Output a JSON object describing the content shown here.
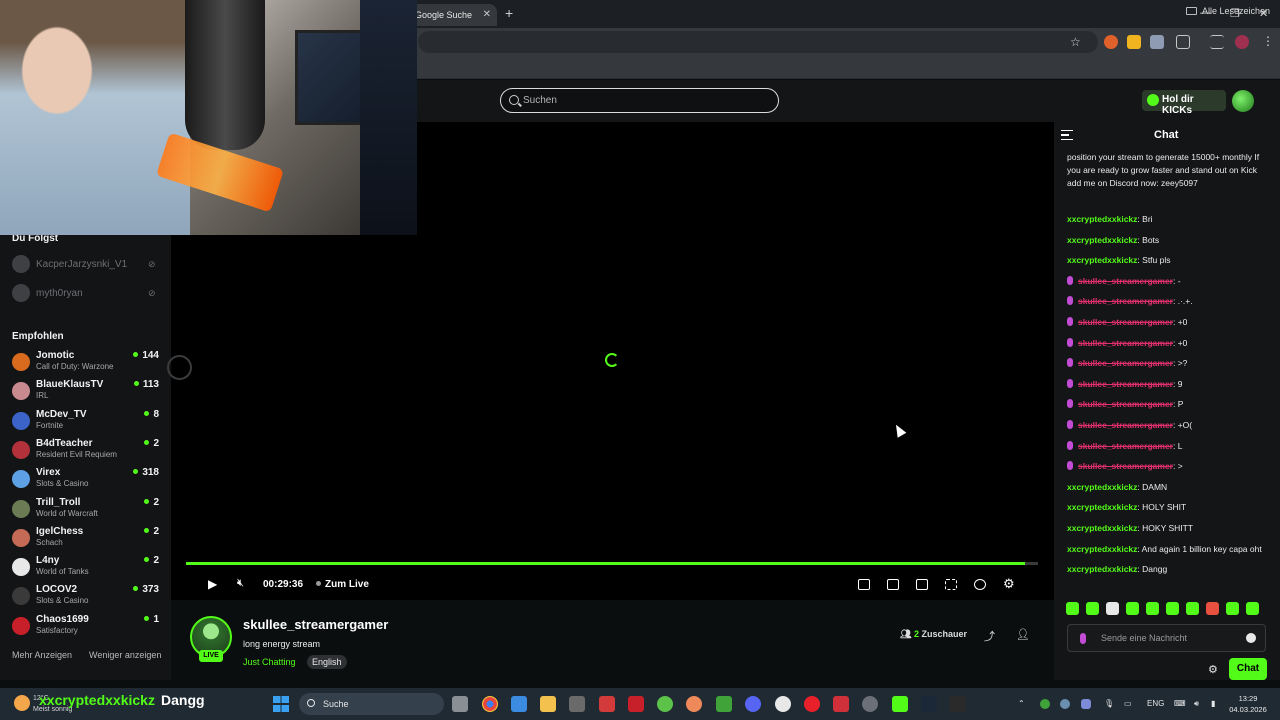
{
  "browser": {
    "tab_title": "Google Suche",
    "tab_close": "✕",
    "new_tab": "+",
    "bookmarks_all": "Alle Lesezeichen"
  },
  "header": {
    "search_placeholder": "Suchen",
    "kicks_button": "Hol dir KICKs"
  },
  "sidebar": {
    "following_heading": "Du Folgst",
    "following": [
      {
        "name": "KacperJarzysnki_V1"
      },
      {
        "name": "myth0ryan"
      }
    ],
    "recommended_heading": "Empfohlen",
    "recommended": [
      {
        "name": "Jomotic",
        "category": "Call of Duty: Warzone",
        "viewers": "144",
        "color": "#d96b1e"
      },
      {
        "name": "BlaueKlausTV",
        "category": "IRL",
        "viewers": "113",
        "color": "#c98a8f"
      },
      {
        "name": "McDev_TV",
        "category": "Fortnite",
        "viewers": "8",
        "color": "#3c64c8"
      },
      {
        "name": "B4dTeacher",
        "category": "Resident Evil Requiem",
        "viewers": "2",
        "color": "#b2313a"
      },
      {
        "name": "Virex",
        "category": "Slots & Casino",
        "viewers": "318",
        "color": "#5ea0e4"
      },
      {
        "name": "Trill_Troll",
        "category": "World of Warcraft",
        "viewers": "2",
        "color": "#6b7c54"
      },
      {
        "name": "IgelChess",
        "category": "Schach",
        "viewers": "2",
        "color": "#c66a58"
      },
      {
        "name": "L4ny",
        "category": "World of Tanks",
        "viewers": "2",
        "color": "#e8e8e8"
      },
      {
        "name": "LOCOV2",
        "category": "Slots & Casino",
        "viewers": "373",
        "color": "#3a3a3a"
      },
      {
        "name": "Chaos1699",
        "category": "Satisfactory",
        "viewers": "1",
        "color": "#c8202a"
      }
    ],
    "show_more": "Mehr Anzeigen",
    "show_less": "Weniger anzeigen"
  },
  "player": {
    "time": "00:29:36",
    "go_live": "Zum Live",
    "progress": 0.985
  },
  "stream": {
    "streamer": "skullee_streamergamer",
    "title": "long energy stream",
    "category": "Just Chatting",
    "language": "English",
    "live_badge": "LIVE",
    "viewer_count": "2",
    "viewer_label": "Zuschauer"
  },
  "chat": {
    "title": "Chat",
    "input_placeholder": "Sende eine Nachricht",
    "send_button": "Chat",
    "pinned_text": "position your stream to generate 15000+ monthly If you are ready to grow faster and stand out on Kick add me on Discord now: zeey5097",
    "messages": [
      {
        "user": "xxcryptedxxkickz",
        "text": ": Bri",
        "style": "green"
      },
      {
        "user": "xxcryptedxxkickz",
        "text": ": Bots",
        "style": "green"
      },
      {
        "user": "xxcryptedxxkickz",
        "text": ": Stfu pls",
        "style": "green"
      },
      {
        "user": "skullee_streamergamer",
        "text": ": -",
        "style": "pink"
      },
      {
        "user": "skullee_streamergamer",
        "text": ": .·.+.",
        "style": "pink"
      },
      {
        "user": "skullee_streamergamer",
        "text": ": +0",
        "style": "pink"
      },
      {
        "user": "skullee_streamergamer",
        "text": ": +0",
        "style": "pink"
      },
      {
        "user": "skullee_streamergamer",
        "text": ": >?",
        "style": "pink"
      },
      {
        "user": "skullee_streamergamer",
        "text": ": 9",
        "style": "pink"
      },
      {
        "user": "skullee_streamergamer",
        "text": ": P",
        "style": "pink"
      },
      {
        "user": "skullee_streamergamer",
        "text": ": +O(",
        "style": "pink"
      },
      {
        "user": "skullee_streamergamer",
        "text": ": L",
        "style": "pink"
      },
      {
        "user": "skullee_streamergamer",
        "text": ": >",
        "style": "pink"
      },
      {
        "user": "xxcryptedxxkickz",
        "text": ": DAMN",
        "style": "green"
      },
      {
        "user": "xxcryptedxxkickz",
        "text": ": HOLY SHIT",
        "style": "green"
      },
      {
        "user": "xxcryptedxxkickz",
        "text": ": HOKY SHITT",
        "style": "green"
      },
      {
        "user": "xxcryptedxxkickz",
        "text": ": And again 1 billion key capa oht",
        "style": "green"
      },
      {
        "user": "xxcryptedxxkickz",
        "text": ": Dangg",
        "style": "green"
      }
    ]
  },
  "overlay": {
    "last_user": "xxcryptedxxkickz",
    "last_text": "Dangg"
  },
  "taskbar": {
    "weather_temp": "12°C",
    "weather_text": "Meist sonnig",
    "search_label": "Suche",
    "lang": "ENG",
    "time": "13:29",
    "date": "04.03.2026"
  },
  "colors": {
    "kick_green": "#53fc18",
    "chat_pink": "#e0306b"
  }
}
